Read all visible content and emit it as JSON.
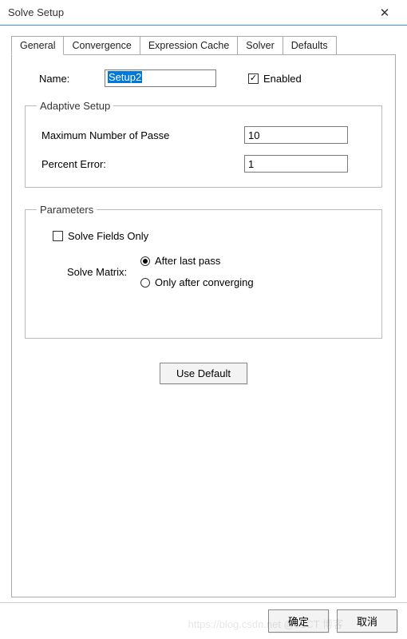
{
  "window": {
    "title": "Solve Setup"
  },
  "tabs": {
    "items": [
      {
        "label": "General"
      },
      {
        "label": "Convergence"
      },
      {
        "label": "Expression Cache"
      },
      {
        "label": "Solver"
      },
      {
        "label": "Defaults"
      }
    ],
    "active_index": 0
  },
  "general": {
    "name_label": "Name:",
    "name_value": "Setup2",
    "enabled_label": "Enabled",
    "enabled_checked": true,
    "adaptive": {
      "legend": "Adaptive Setup",
      "max_passes_label": "Maximum Number of Passe",
      "max_passes_value": "10",
      "percent_error_label": "Percent Error:",
      "percent_error_value": "1"
    },
    "parameters": {
      "legend": "Parameters",
      "solve_fields_only_label": "Solve Fields Only",
      "solve_fields_only_checked": false,
      "solve_matrix_label": "Solve Matrix:",
      "options": [
        {
          "label": "After last pass",
          "selected": true
        },
        {
          "label": "Only after converging",
          "selected": false
        }
      ]
    },
    "use_default_label": "Use Default"
  },
  "footer": {
    "ok_label": "确定",
    "cancel_label": "取消"
  },
  "watermark": "https://blog.csdn.net @51CT 博客"
}
